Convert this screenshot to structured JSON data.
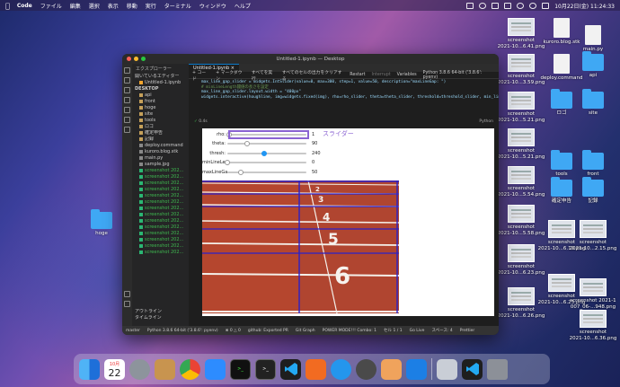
{
  "menubar": {
    "app_name": "Code",
    "items": [
      "ファイル",
      "編集",
      "選択",
      "表示",
      "移動",
      "実行",
      "ターミナル",
      "ウィンドウ",
      "ヘルプ"
    ],
    "datetime": "10月22日(金) 11:24:33"
  },
  "desktop": {
    "hoge_label": "hoge",
    "right_icons": [
      {
        "label": "screenshot\n2021-10...6.41.png",
        "kind": "shot"
      },
      {
        "label": "kuroro.blog.stk",
        "kind": "doc"
      },
      {
        "label": "main.py",
        "kind": "doc"
      },
      {
        "label": "screenshot\n2021-10...3.59.png",
        "kind": "shot"
      },
      {
        "label": "deploy.command",
        "kind": "doc"
      },
      {
        "label": "api",
        "kind": "folder"
      },
      {
        "label": "screenshot\n2021-10...5.21.png",
        "kind": "shot"
      },
      {
        "label": "ロゴ",
        "kind": "folder"
      },
      {
        "label": "site",
        "kind": "folder"
      },
      {
        "label": "screenshot\n2021-10...5.21.png",
        "kind": "shot"
      },
      {
        "label": "tools",
        "kind": "folder"
      },
      {
        "label": "front",
        "kind": "folder"
      },
      {
        "label": "screenshot\n2021-10...5.54.png",
        "kind": "shot"
      },
      {
        "label": "確定申告",
        "kind": "folder"
      },
      {
        "label": "記録",
        "kind": "folder"
      },
      {
        "label": "screenshot\n2021-10...5.58.png",
        "kind": "shot"
      },
      {
        "label": "screenshot\n2021-10...6.19.png",
        "kind": "shot"
      },
      {
        "label": "screenshot\n2021-10...2.15.png",
        "kind": "shot"
      },
      {
        "label": "screenshot\n2021-10...6.23.png",
        "kind": "shot"
      },
      {
        "label": "screenshot\n2021-10...6.23.png",
        "kind": "shot"
      },
      {
        "label": "screenshot 2021-1\n007_06-...948.png",
        "kind": "shot"
      },
      {
        "label": "screenshot\n2021-10...6.26.png",
        "kind": "shot"
      },
      {
        "label": "screenshot\n2021-10...6.36.png",
        "kind": "shot"
      }
    ]
  },
  "window": {
    "title": "Untitled-1.ipynb — Desktop",
    "explorer_title": "エクスプローラー",
    "open_editors": "開いているエディター",
    "open_file": "Untitled-1.ipynb",
    "desktop_section": "DESKTOP",
    "files": [
      {
        "name": "api",
        "kind": "folder"
      },
      {
        "name": "front",
        "kind": "folder"
      },
      {
        "name": "hoge",
        "kind": "folder"
      },
      {
        "name": "site",
        "kind": "folder"
      },
      {
        "name": "tools",
        "kind": "folder"
      },
      {
        "name": "ロゴ",
        "kind": "folder"
      },
      {
        "name": "確定申告",
        "kind": "folder"
      },
      {
        "name": "記録",
        "kind": "folder"
      },
      {
        "name": "deploy.command",
        "kind": "file"
      },
      {
        "name": "kuroro.blog.stk",
        "kind": "file"
      },
      {
        "name": "main.py",
        "kind": "file"
      },
      {
        "name": "sample.jpg",
        "kind": "file"
      },
      {
        "name": "screenshot 202...",
        "kind": "img"
      },
      {
        "name": "screenshot 202...",
        "kind": "img"
      },
      {
        "name": "screenshot 202...",
        "kind": "img"
      },
      {
        "name": "screenshot 202...",
        "kind": "img"
      },
      {
        "name": "screenshot 202...",
        "kind": "img"
      },
      {
        "name": "screenshot 202...",
        "kind": "img"
      },
      {
        "name": "screenshot 202...",
        "kind": "img"
      },
      {
        "name": "screenshot 202...",
        "kind": "img"
      },
      {
        "name": "screenshot 202...",
        "kind": "img"
      },
      {
        "name": "screenshot 202...",
        "kind": "img"
      },
      {
        "name": "screenshot 202...",
        "kind": "img"
      },
      {
        "name": "screenshot 202...",
        "kind": "img"
      },
      {
        "name": "screenshot 202...",
        "kind": "img"
      },
      {
        "name": "screenshot 202...",
        "kind": "img"
      }
    ],
    "outline": "アウトライン",
    "timeline": "タイムライン",
    "tab_label": "Untitled-1.ipynb",
    "toolbar": {
      "code": "+ コード",
      "markdown": "+ マークダウン",
      "run_all": "すべてを実行",
      "clear_all": "すべてのセルの出力をクリアする",
      "restart": "Restart",
      "interrupt": "Interrupt",
      "variables": "Variables",
      "kernel": "Python 3.8.6 64-bit ('3.8.6': pyenv)"
    },
    "code_lines": [
      "max_line_gap_slider = widgets.IntSlider(value=0, max=300, step=1, value=50, description=\"maxLineGap: \")",
      "# minLineLength閾値の長さを設定",
      "max_line_gap_slider.layout.width = \"400px\"",
      "",
      "widgets.interactive(houghline, img=widgets.fixed(img), rho=rho_slider, theta=theta_slider, threshold=threshold_slider, min_line"
    ],
    "cell_time": "0.4s",
    "cell_lang": "Python",
    "sliders": [
      {
        "label": "rho:",
        "value": "1",
        "level": 0.02,
        "active": false
      },
      {
        "label": "theta:",
        "value": "90",
        "level": 0.25,
        "active": false
      },
      {
        "label": "thresh:",
        "value": "240",
        "level": 0.47,
        "active": true
      },
      {
        "label": "minLineLe...",
        "value": "0",
        "level": 0.0,
        "active": false
      },
      {
        "label": "maxLineGa...",
        "value": "50",
        "level": 0.17,
        "active": false
      }
    ],
    "annotation": "スライダー",
    "track_numbers": [
      "2",
      "3",
      "4",
      "5",
      "6"
    ],
    "status_items": [
      "master",
      "Python 3.8.6 64-bit ('3.8.6': pyenv)",
      "⊗ 0 △ 0",
      "github: Exported PR",
      "Git Graph",
      "POWER MODE!!! Combo: 1",
      "セル 1 / 1",
      "Go Live",
      "スペース: 4",
      "Prettier"
    ]
  },
  "dock": {
    "calendar_month": "10月",
    "calendar_day": "22",
    "terminal_text": ">_",
    "items": [
      "finder-icon",
      "launchpad-icon",
      "system-preferences-icon",
      "contacts-icon",
      "chrome-icon",
      "zoom-icon",
      "iterm-icon",
      "terminal-icon",
      "vscode-icon",
      "activity-monitor-icon",
      "docker-icon",
      "quicktime-icon",
      "preview-icon",
      "infinity-icon",
      "screenshot-icon",
      "vscode-2-icon",
      "trash-icon"
    ]
  }
}
